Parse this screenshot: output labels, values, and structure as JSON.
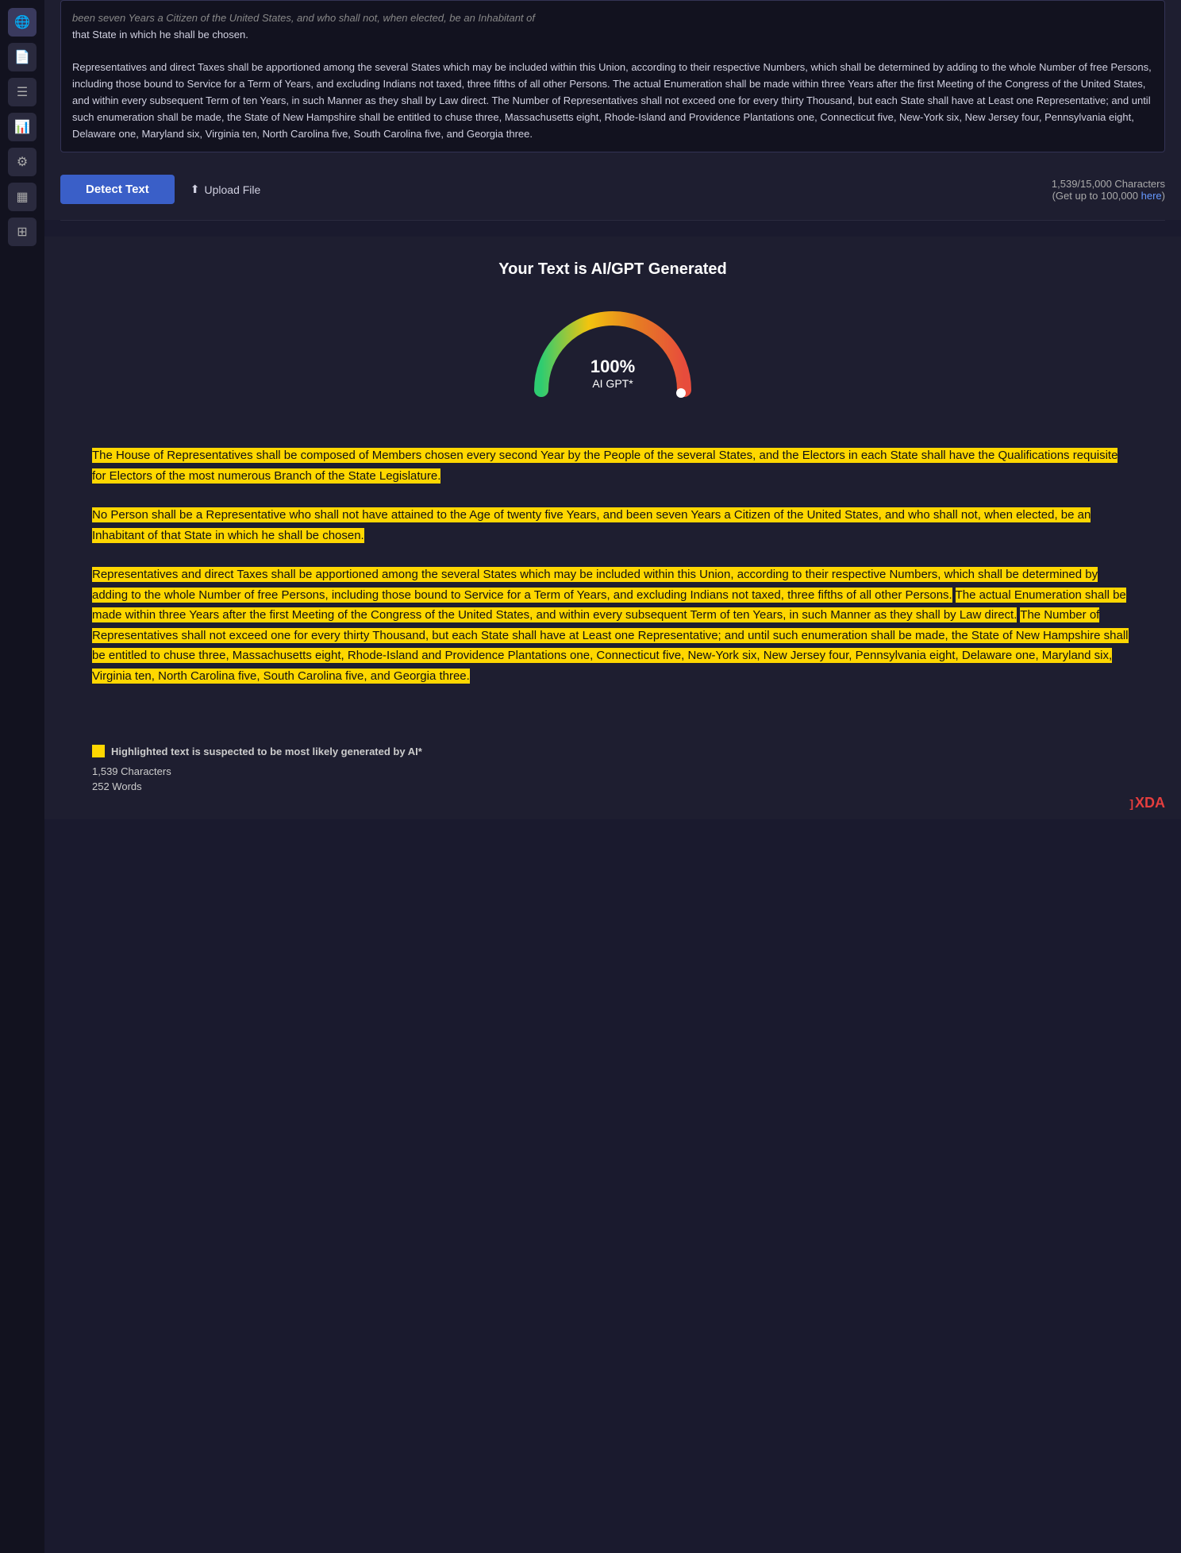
{
  "sidebar": {
    "icons": [
      {
        "name": "globe-icon",
        "symbol": "🌐",
        "active": true
      },
      {
        "name": "file-icon",
        "symbol": "📄",
        "active": false
      },
      {
        "name": "list-icon",
        "symbol": "☰",
        "active": false
      },
      {
        "name": "chart-icon",
        "symbol": "📊",
        "active": false
      },
      {
        "name": "settings-icon",
        "symbol": "⚙",
        "active": false
      },
      {
        "name": "table-icon",
        "symbol": "▦",
        "active": false
      },
      {
        "name": "grid-icon",
        "symbol": "⊞",
        "active": false
      }
    ]
  },
  "text_area": {
    "first_line": "been seven Years a Citizen of the United States, and who shall not, when elected, be an Inhabitant of",
    "second_line": "that State in which he shall be chosen.",
    "body": "Representatives and direct Taxes shall be apportioned among the several States which may be included within this Union, according to their respective Numbers, which shall be determined by adding to the whole Number of free Persons, including those bound to Service for a Term of Years, and excluding Indians not taxed, three fifths of all other Persons. The actual Enumeration shall be made within three Years after the first Meeting of the Congress of the United States, and within every subsequent Term of ten Years, in such Manner as they shall by Law direct. The Number of Representatives shall not exceed one for every thirty Thousand, but each State shall have at Least one Representative; and until such enumeration shall be made, the State of New Hampshire shall be entitled to chuse three, Massachusetts eight, Rhode-Island and Providence Plantations one, Connecticut five, New-York six, New Jersey four, Pennsylvania eight, Delaware one, Maryland six, Virginia ten, North Carolina five, South Carolina five, and Georgia three."
  },
  "action_bar": {
    "detect_button": "Detect Text",
    "upload_button": "Upload File",
    "char_count": "1,539/15,000 Characters",
    "upgrade_text": "(Get up to 100,000 ",
    "upgrade_link": "here",
    "upgrade_close": ")"
  },
  "results": {
    "title": "Your Text is AI/GPT Generated",
    "gauge_percent": "100%",
    "gauge_label": "AI GPT*"
  },
  "highlighted_paragraphs": [
    {
      "id": 1,
      "text": "The House of Representatives shall be composed of Members chosen every second Year by the People of the several States, and the Electors in each State shall have the Qualifications requisite for Electors of the most numerous Branch of the State Legislature.",
      "highlighted": true
    },
    {
      "id": 2,
      "text": "No Person shall be a Representative who shall not have attained to the Age of twenty five Years, and been seven Years a Citizen of the United States, and who shall not, when elected, be an Inhabitant of that State in which he shall be chosen.",
      "highlighted": true
    },
    {
      "id": 3,
      "part1": "Representatives and direct Taxes shall be apportioned among the several States which may be included within this Union, according to their respective Numbers, which shall be determined by adding to the whole Number of free Persons, including those bound to Service for a Term of Years, and excluding Indians not taxed, three fifths of all other Persons.",
      "part2": "The actual Enumeration shall be made within three Years after the first Meeting of the Congress of the United States, and within every subsequent Term of ten Years, in such Manner as they shall by Law direct.",
      "part3": "The Number of Representatives shall not exceed one for every thirty Thousand, but each State shall have at Least one Representative; and until such enumeration shall be made, the State of New Hampshire shall be entitled to chuse three, Massachusetts eight, Rhode-Island and Providence Plantations one, Connecticut five, New-York six, New Jersey four, Pennsylvania eight, Delaware one, Maryland six, Virginia ten, North Carolina five, South Carolina five, and Georgia three.",
      "highlighted": true
    }
  ],
  "footer": {
    "legend_text": "Highlighted text is suspected to be most likely generated by AI*",
    "char_count_label": "1,539 Characters",
    "word_count_label": "252 Words",
    "xda_logo": "]XDA"
  }
}
